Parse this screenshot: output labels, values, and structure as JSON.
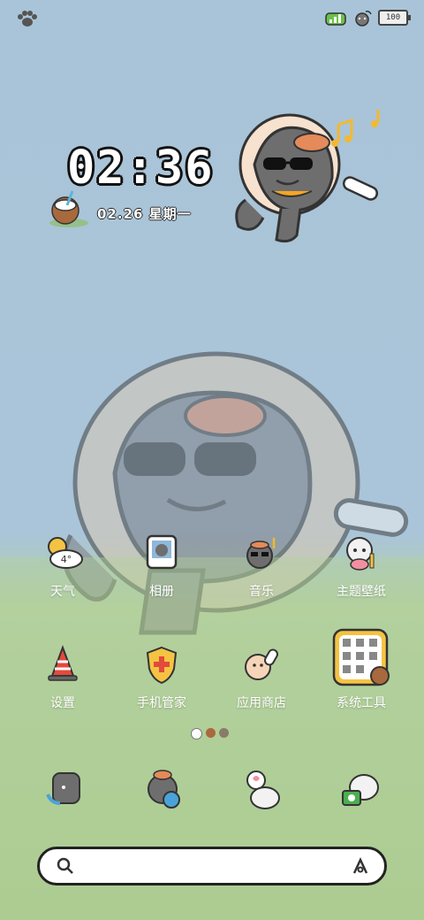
{
  "status_bar": {
    "left_icon": "paw-icon",
    "battery_level": "100",
    "icons": [
      "signal-icon",
      "wifi-icon",
      "battery-icon"
    ]
  },
  "clock": {
    "time": "02:36",
    "date": "02.26 星期一"
  },
  "apps_row1": [
    {
      "label": "天气",
      "icon": "weather-icon",
      "temp": "4°"
    },
    {
      "label": "相册",
      "icon": "gallery-icon"
    },
    {
      "label": "音乐",
      "icon": "music-icon"
    },
    {
      "label": "主题壁纸",
      "icon": "theme-icon"
    }
  ],
  "apps_row2": [
    {
      "label": "设置",
      "icon": "settings-icon"
    },
    {
      "label": "手机管家",
      "icon": "phone-manager-icon"
    },
    {
      "label": "应用商店",
      "icon": "app-store-icon"
    },
    {
      "label": "系统工具",
      "icon": "system-tools-icon"
    }
  ],
  "page_indicator": {
    "pages": 3,
    "current": 1
  },
  "dock": [
    {
      "icon": "phone-icon"
    },
    {
      "icon": "browser-icon"
    },
    {
      "icon": "messages-icon"
    },
    {
      "icon": "camera-icon"
    }
  ],
  "search": {
    "icon": "search-icon",
    "brand_icon": "brand-icon"
  },
  "colors": {
    "sky": "#a9c4d8",
    "grass": "#a8c98c",
    "accent": "#f5c343"
  }
}
